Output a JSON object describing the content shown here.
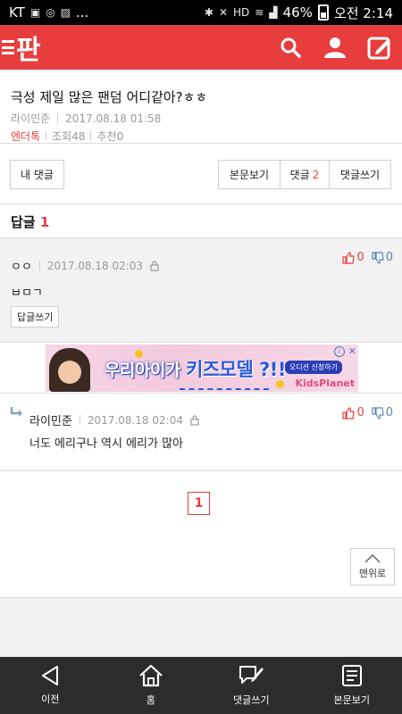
{
  "status": {
    "carrier": "KT",
    "battery": "46%",
    "time": "오전 2:14",
    "dots": "..."
  },
  "header": {
    "logo": "판",
    "icons": [
      "menu-icon",
      "search-icon",
      "profile-icon",
      "compose-icon"
    ]
  },
  "post": {
    "title": "극성 제일 많은 팬덤 어디같아?ㅎㅎ",
    "author": "라이민준",
    "datetime": "2017.08.18 01:58",
    "category": "엔더톡",
    "views": "조회48",
    "likes": "추천0"
  },
  "buttons": {
    "my_comments": "내 댓글",
    "view_post": "본문보기",
    "comments_label": "댓글",
    "comments_count": "2",
    "write_comment": "댓글쓰기"
  },
  "replies": {
    "label": "답글",
    "count": "1"
  },
  "comments": [
    {
      "author": "ㅇㅇ",
      "datetime": "2017.08.18 02:03",
      "up": "0",
      "down": "0",
      "text": "ㅂㅁㄱ",
      "reply_button": "답글쓰기"
    },
    {
      "author": "라이민준",
      "datetime": "2017.08.18 02:04",
      "up": "0",
      "down": "0",
      "text": "너도 에리구나 역시 에리가 많아"
    }
  ],
  "ad": {
    "headline_a": "우리아이가",
    "headline_b": "키즈모델 ?!!",
    "cta": "오디션 신청하기",
    "brand": "KidsPlanet",
    "info": "i",
    "close": "✕"
  },
  "pagination": {
    "current": "1"
  },
  "to_top": "맨위로",
  "bottom_nav": {
    "back": "이전",
    "home": "홈",
    "write": "댓글쓰기",
    "view_post": "본문보기"
  },
  "colors": {
    "brand_red": "#e83d3d",
    "down_blue": "#5a86b5"
  }
}
